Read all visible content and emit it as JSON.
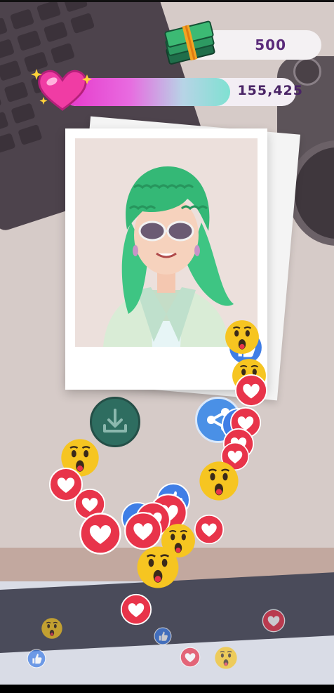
{
  "hud": {
    "cash_value": "500",
    "cash_icon": "cash-stack-icon",
    "love_value": "155,425",
    "love_icon": "pink-heart-icon",
    "love_progress_fraction": 0.72
  },
  "actions": {
    "download_icon": "download-icon",
    "share_icon": "share-icon"
  },
  "reactions": {
    "types": [
      "heart",
      "wow",
      "like"
    ],
    "colors": {
      "heart": "#e8344a",
      "wow": "#f6c521",
      "like": "#3f7ee6"
    }
  },
  "colors": {
    "accent_pink": "#e636c9",
    "accent_teal": "#7fe1d2",
    "text_purple": "#5a2a7a"
  }
}
